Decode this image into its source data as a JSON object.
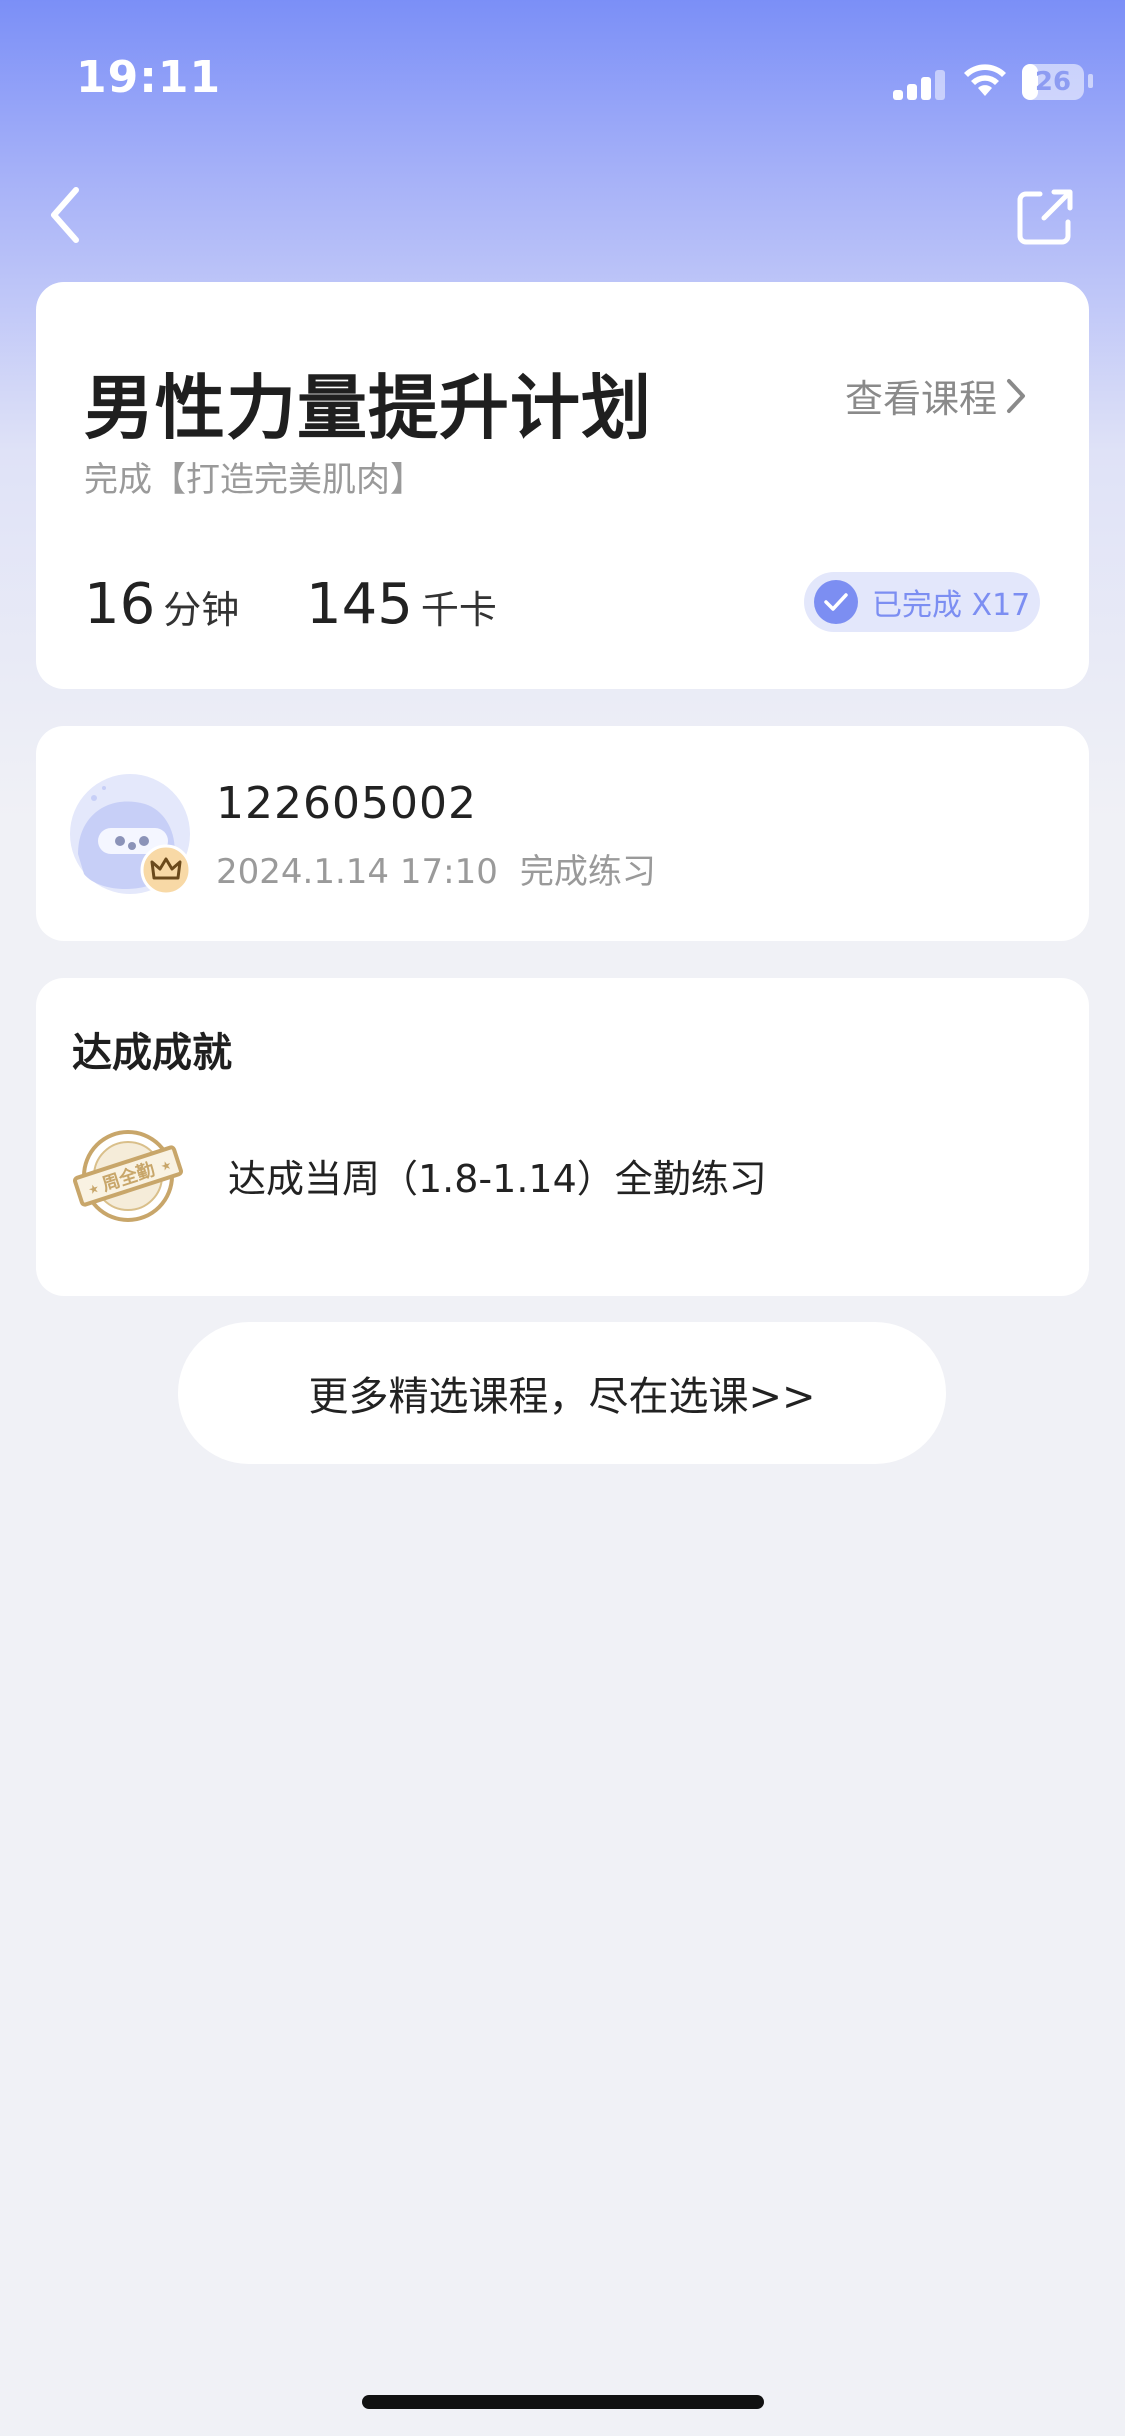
{
  "status_bar": {
    "time": "19:11",
    "battery_level": "26",
    "battery_fraction": 0.26,
    "signal_icon": "cellular-signal-icon",
    "wifi_icon": "wifi-icon"
  },
  "nav": {
    "back_icon": "chevron-left-icon",
    "share_icon": "share-icon"
  },
  "course": {
    "title": "男性力量提升计划",
    "view_course_label": "查看课程",
    "subtitle": "完成【打造完美肌肉】",
    "duration_value": "16",
    "duration_unit": "分钟",
    "calories_value": "145",
    "calories_unit": "千卡",
    "completed_label": "已完成 X17"
  },
  "user": {
    "id": "122605002",
    "date": "2024.1.14 17:10",
    "action": "完成练习"
  },
  "achievement": {
    "section_title": "达成成就",
    "medal_icon": "weekly-attendance-medal-icon",
    "medal_text": "周全勤",
    "description": "达成当周（1.8-1.14）全勤练习"
  },
  "more_courses_label": "更多精选课程，尽在选课>>",
  "colors": {
    "accent": "#7c8ef2",
    "header_gradient_top": "#7b8ff7",
    "background": "#f0f1f6",
    "medal_gold": "#c8a66a"
  }
}
